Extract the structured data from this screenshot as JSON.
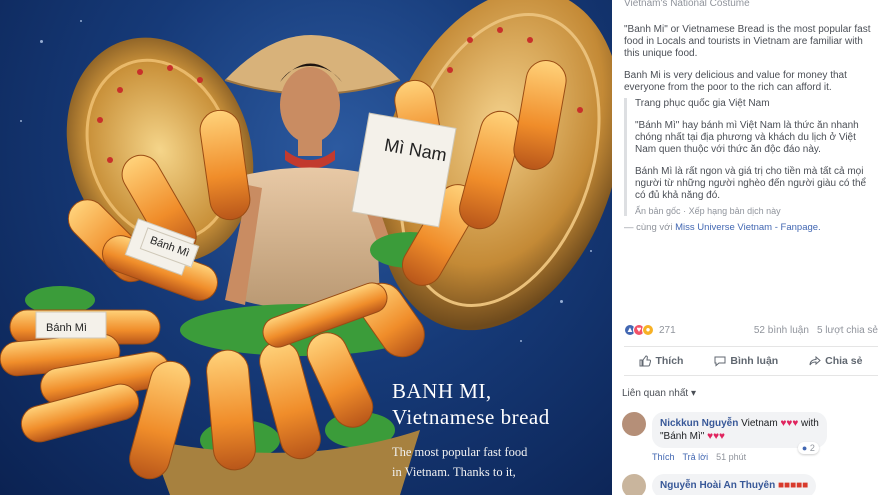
{
  "photo": {
    "caption_title_1": "BANH MI,",
    "caption_title_2": "Vietnamese bread",
    "caption_body_1": "The most popular fast food",
    "caption_body_2": "in Vietnam. Thanks to it,",
    "bag_label_1": "Bánh Mì",
    "bag_label_2": "Mì Nam",
    "bag_label_3": "Bánh Mì"
  },
  "post": {
    "top_line": "Vietnam's National Costume",
    "p1": "\"Banh Mi\" or Vietnamese Bread is the most popular fast food in Locals and tourists in Vietnam are familiar with this unique food.",
    "p2": "Banh Mi is very delicious and value for money that everyone from the poor to the rich can afford it.",
    "tr_title": "Trang phục quốc gia Việt Nam",
    "tr_p1": "\"Bánh Mì\" hay bánh mì Việt Nam là thức ăn nhanh chóng nhất tại địa phương và khách du lịch ở Việt Nam quen thuộc với thức ăn độc đáo này.",
    "tr_p2": "Bánh Mì là rất ngon và giá trị cho tiền mà tất cả mọi người từ những người nghèo đến người giàu có thể có đủ khả năng đó.",
    "tr_hide": "Ẩn bản gốc",
    "tr_rate": "Xếp hạng bản dịch này",
    "with_prefix": "— cùng với",
    "with_link": "Miss Universe Vietnam - Fanpage."
  },
  "reactions": {
    "count": "271",
    "comments": "52 bình luận",
    "shares": "5 lượt chia sẻ"
  },
  "actions": {
    "like": "Thích",
    "comment": "Bình luận",
    "share": "Chia sẻ"
  },
  "sort": {
    "label": "Liên quan nhất ▾"
  },
  "comments": [
    {
      "author": "Nickkun Nguyễn",
      "text_1": "Vietnam",
      "text_2": "with",
      "text_3": "\"Bánh Mì\"",
      "like": "Thích",
      "reply": "Trả lời",
      "time": "51 phút",
      "likes": "2"
    },
    {
      "author": "Nguyễn Hoài An Thuyên"
    }
  ]
}
